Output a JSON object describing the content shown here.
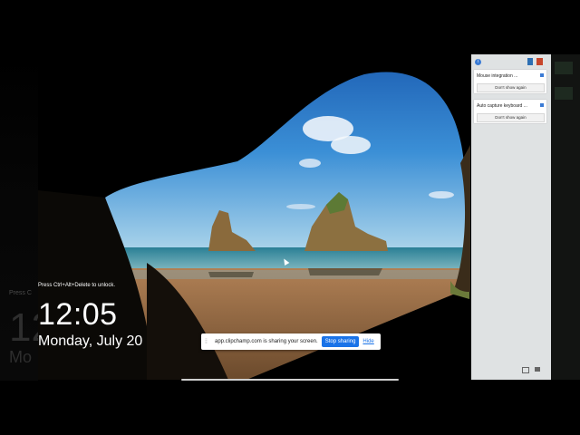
{
  "vm_lock_screen": {
    "unlock_hint": "Press Ctrl+Alt+Delete to unlock.",
    "time": "12:05",
    "date": "Monday, July 20"
  },
  "ghost_copy": {
    "hint": "Press C",
    "time": "12",
    "date": "Mo"
  },
  "share_bar": {
    "grip": "⁞⁞",
    "message": "app.clipchamp.com is sharing your screen.",
    "stop_label": "Stop sharing",
    "hide_label": "Hide"
  },
  "panel": {
    "info_icon": "i",
    "notices": [
      {
        "title": "Mouse integration ...",
        "button": "Don't show again"
      },
      {
        "title": "Auto capture keyboard ...",
        "button": "Don't show again"
      }
    ]
  },
  "colors": {
    "accent_blue": "#1a73e8",
    "panel_bg": "#dfe2e3"
  }
}
